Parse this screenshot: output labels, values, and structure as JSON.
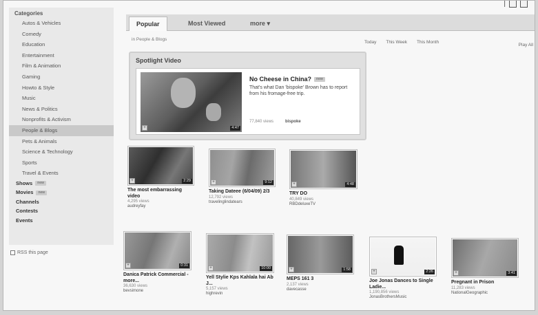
{
  "sidebar": {
    "heading": "Categories",
    "categories": [
      "Autos & Vehicles",
      "Comedy",
      "Education",
      "Entertainment",
      "Film & Animation",
      "Gaming",
      "Howto & Style",
      "Music",
      "News & Politics",
      "Nonprofits & Activism",
      "People & Blogs",
      "Pets & Animals",
      "Science & Technology",
      "Sports",
      "Travel & Events"
    ],
    "selected_category": "People & Blogs",
    "sections": [
      {
        "label": "Shows",
        "badge": "new"
      },
      {
        "label": "Movies",
        "badge": "new"
      },
      {
        "label": "Channels",
        "badge": ""
      },
      {
        "label": "Contests",
        "badge": ""
      },
      {
        "label": "Events",
        "badge": ""
      }
    ],
    "rss_label": "RSS this page"
  },
  "tabs": [
    "Popular",
    "Most Viewed",
    "more ▾"
  ],
  "active_tab": "Popular",
  "breadcrumb": "in People & Blogs",
  "time_filters": [
    "Today",
    "This Week",
    "This Month"
  ],
  "play_all": "Play All",
  "spotlight": {
    "heading": "Spotlight Video",
    "title": "No Cheese in China?",
    "badge": "new",
    "description": "That's what Dan 'bispoke' Brown has to report from his fromage-free trip.",
    "views": "77,840 views",
    "uploader": "bispoke",
    "duration": "4:47"
  },
  "videos": [
    {
      "title": "The most embarrassing video",
      "views": "4,295 views",
      "user": "audreyfay",
      "duration": "2:29"
    },
    {
      "title": "Taking Dateee (6/04/09) 2/3",
      "views": "12,792 views",
      "user": "travelinglindatears",
      "duration": "9:12"
    },
    {
      "title": "TRY DO",
      "views": "40,849 views",
      "user": "RBDdeluxeTV",
      "duration": "4:48"
    },
    {
      "title": "Danica Patrick Commercial - more...",
      "views": "36,630 views",
      "user": "bevsimone",
      "duration": "0:31"
    },
    {
      "title": "Yell Stylie Kps Kahlala hai Ab J...",
      "views": "5,157 views",
      "user": "highrevin",
      "duration": "10:00"
    },
    {
      "title": "MEPS 161 3",
      "views": "2,137 views",
      "user": "davecasse",
      "duration": "1:58"
    },
    {
      "title": "Joe Jonas Dances to Single Ladie...",
      "views": "1,190,856 views",
      "user": "JonasBrothersMusic",
      "duration": "2:26"
    },
    {
      "title": "Pregnant in Prison",
      "views": "11,283 views",
      "user": "NationalGeographic",
      "duration": "3:41"
    }
  ]
}
